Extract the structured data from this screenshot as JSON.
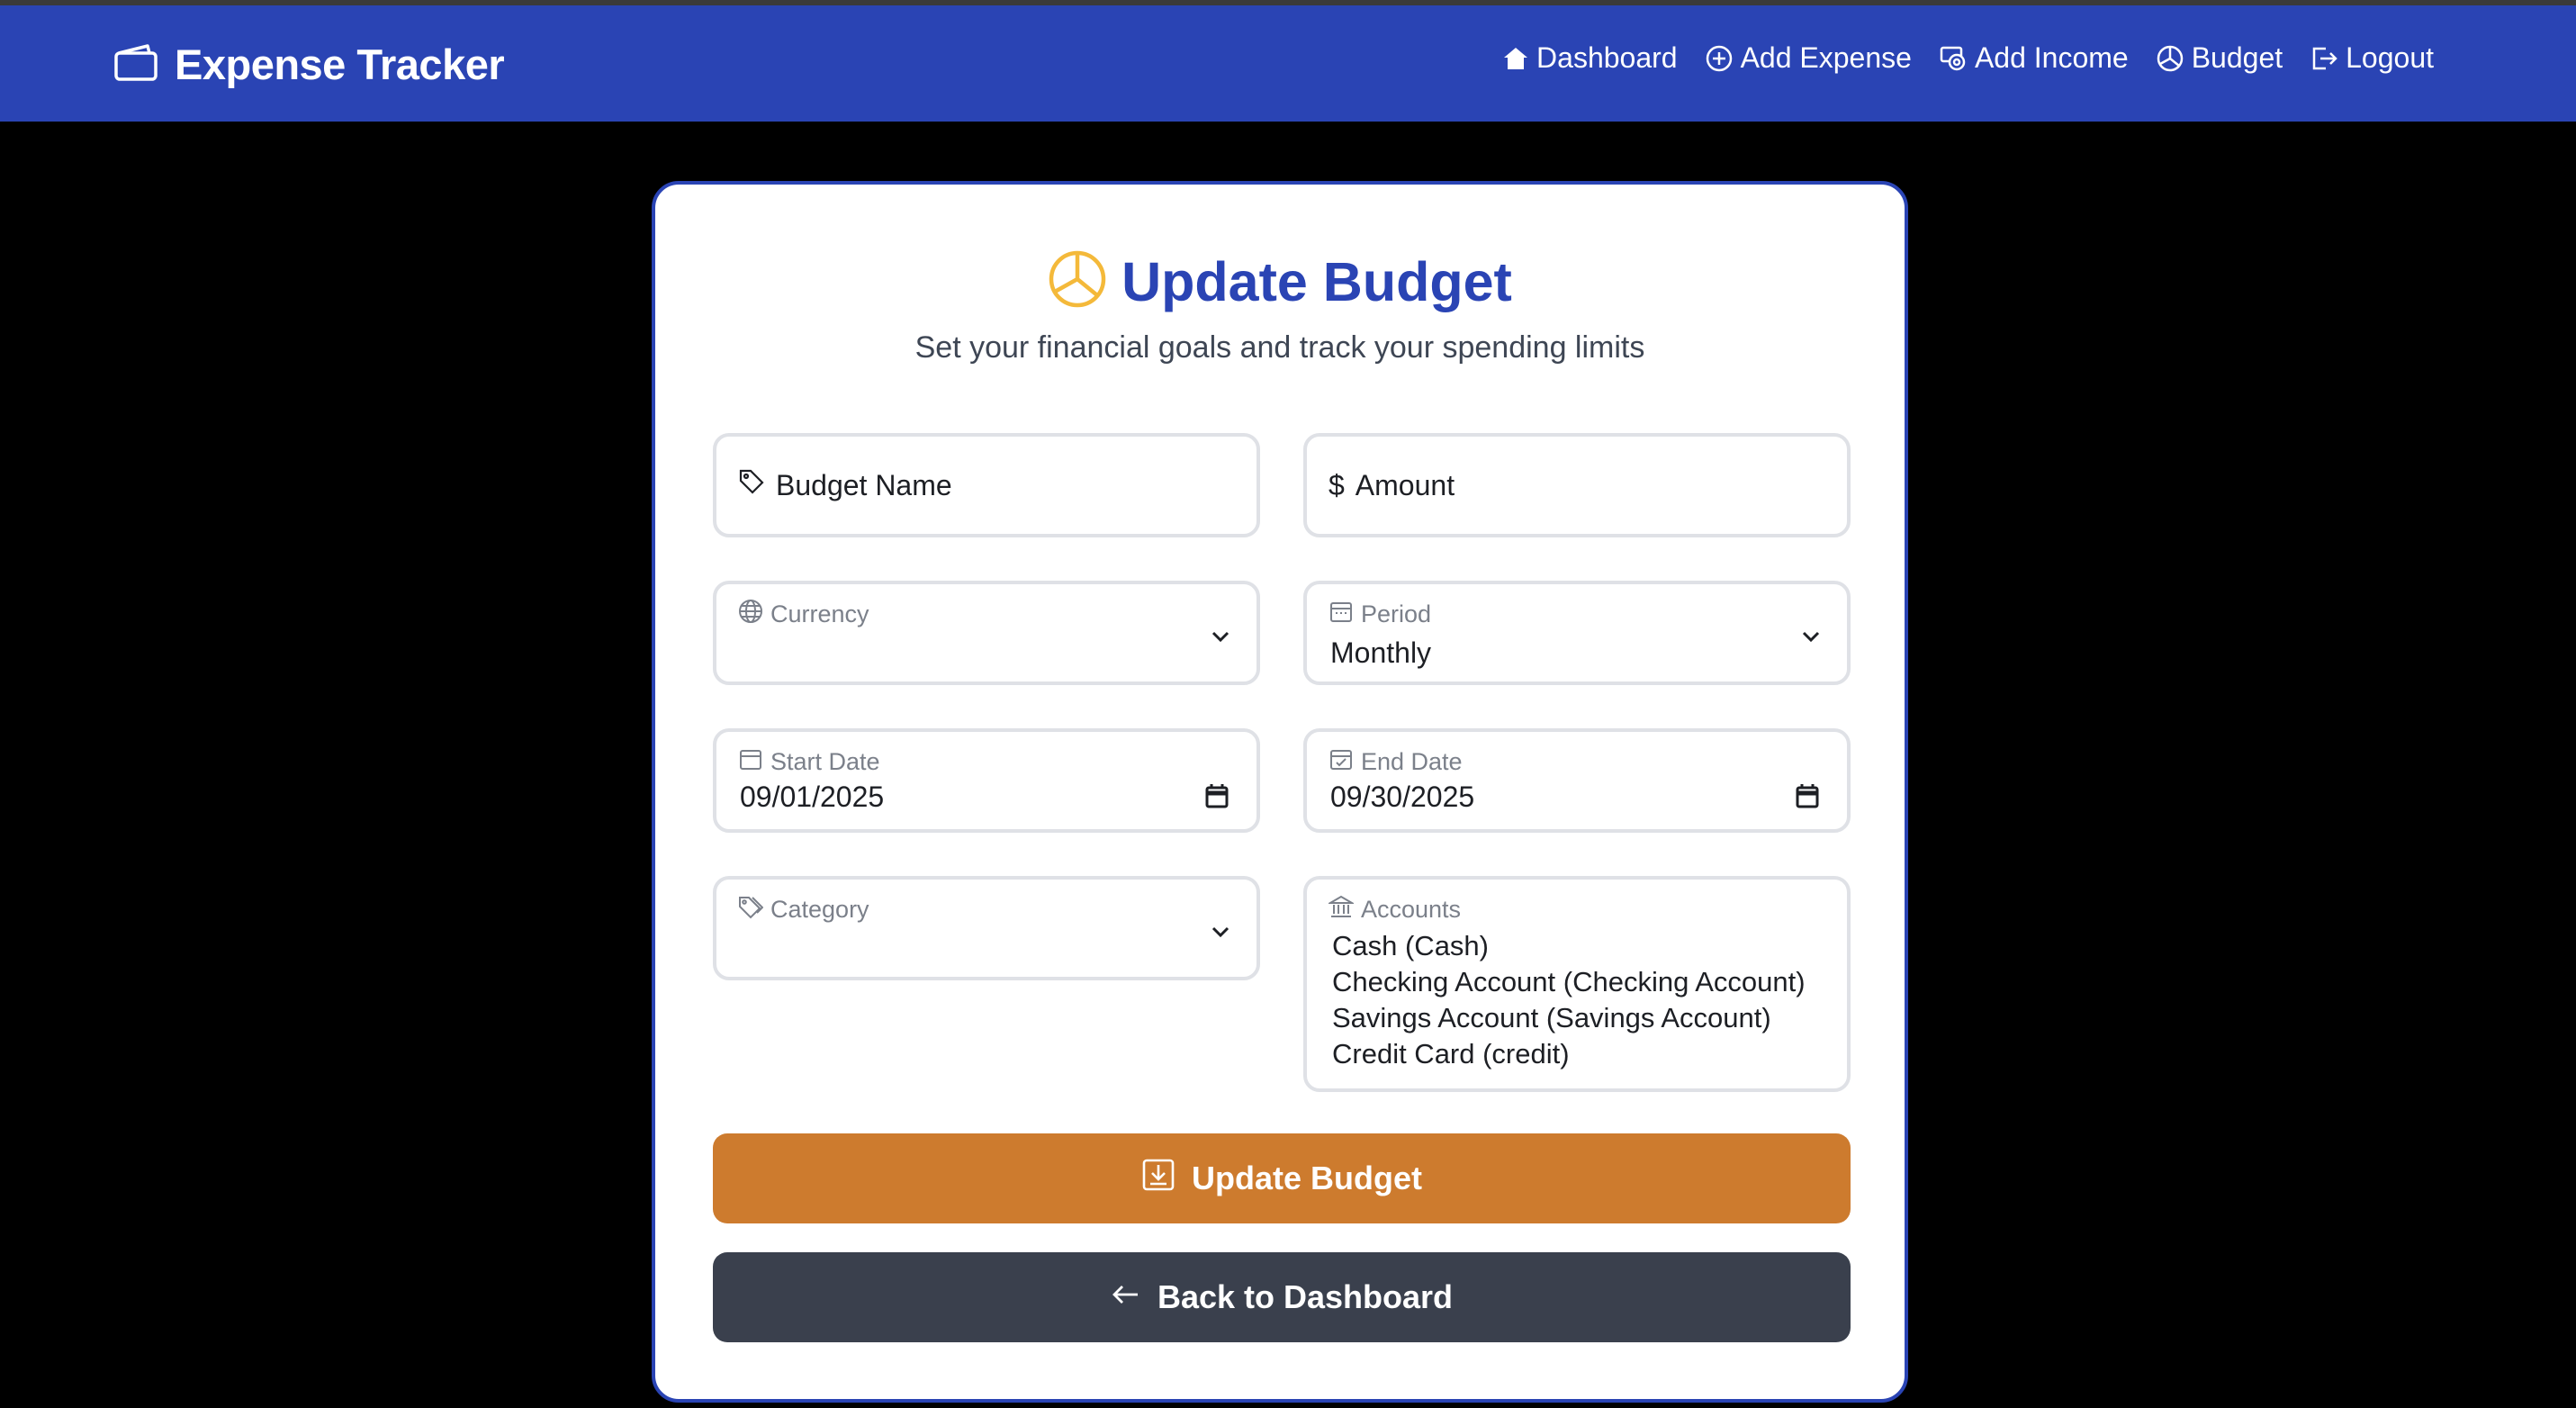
{
  "app": {
    "title": "Expense Tracker"
  },
  "nav": {
    "items": [
      {
        "label": "Dashboard",
        "icon": "home-icon"
      },
      {
        "label": "Add Expense",
        "icon": "plus-circle-icon"
      },
      {
        "label": "Add Income",
        "icon": "cash-icon"
      },
      {
        "label": "Budget",
        "icon": "pie-chart-icon"
      },
      {
        "label": "Logout",
        "icon": "logout-icon"
      }
    ]
  },
  "page": {
    "title": "Update Budget",
    "subtitle": "Set your financial goals and track your spending limits"
  },
  "form": {
    "budget_name": {
      "placeholder": "Budget Name",
      "value": ""
    },
    "amount": {
      "placeholder": "Amount",
      "prefix": "$",
      "value": ""
    },
    "currency": {
      "label": "Currency",
      "value": ""
    },
    "period": {
      "label": "Period",
      "value": "Monthly"
    },
    "start_date": {
      "label": "Start Date",
      "value": "09/01/2025"
    },
    "end_date": {
      "label": "End Date",
      "value": "09/30/2025"
    },
    "category": {
      "label": "Category",
      "value": ""
    },
    "accounts": {
      "label": "Accounts",
      "options": [
        "Cash (Cash)",
        "Checking Account (Checking Account)",
        "Savings Account (Savings Account)",
        "Credit Card (credit)"
      ]
    },
    "submit_label": "Update Budget",
    "back_label": "Back to Dashboard"
  },
  "colors": {
    "navbar": "#2a44b4",
    "title": "#2a44b4",
    "pie_icon": "#f4b93a",
    "update_button": "#cd7b2e",
    "back_button": "#3a404d",
    "background": "#000000"
  }
}
